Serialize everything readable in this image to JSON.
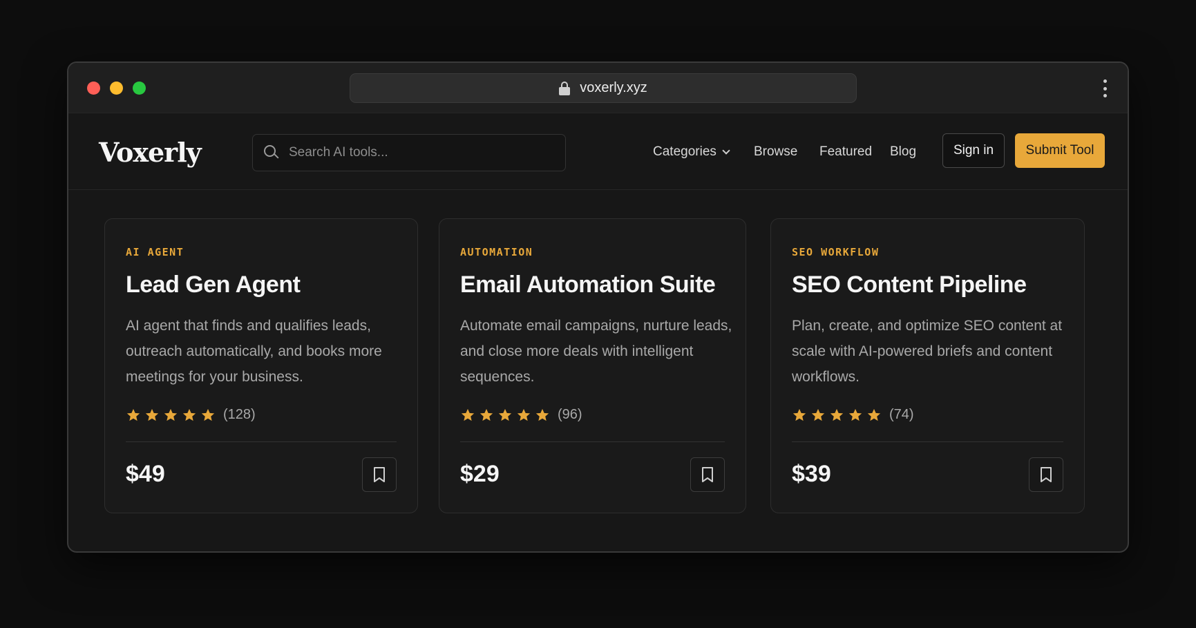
{
  "browser": {
    "url": "voxerly.xyz"
  },
  "nav": {
    "logo": "Voxerly",
    "search_placeholder": "Search AI tools...",
    "links": [
      "Categories",
      "Browse",
      "Featured",
      "Blog"
    ],
    "sign_in": "Sign in",
    "submit_tool": "Submit Tool"
  },
  "cards": [
    {
      "category": "AI AGENT",
      "title": "Lead Gen Agent",
      "description": "AI agent that finds and qualifies leads, outreach automatically, and books more meetings for your business.",
      "stars": 5,
      "rating_count": "(128)",
      "price": "$49"
    },
    {
      "category": "AUTOMATION",
      "title": "Email Automation Suite",
      "description": "Automate email campaigns, nurture leads, and close more deals with intelligent sequences.",
      "stars": 5,
      "rating_count": "(96)",
      "price": "$29"
    },
    {
      "category": "SEO WORKFLOW",
      "title": "SEO Content Pipeline",
      "description": "Plan, create, and optimize SEO content at scale with AI-powered briefs and content workflows.",
      "stars": 5,
      "rating_count": "(74)",
      "price": "$39"
    }
  ],
  "colors": {
    "accent": "#e8a83a",
    "background": "#0d0d0d",
    "card": "#1a1a1a"
  },
  "icons": [
    "lock-icon",
    "kebab-menu-icon",
    "search-icon",
    "chevron-down-icon",
    "star-icon",
    "bookmark-icon"
  ]
}
